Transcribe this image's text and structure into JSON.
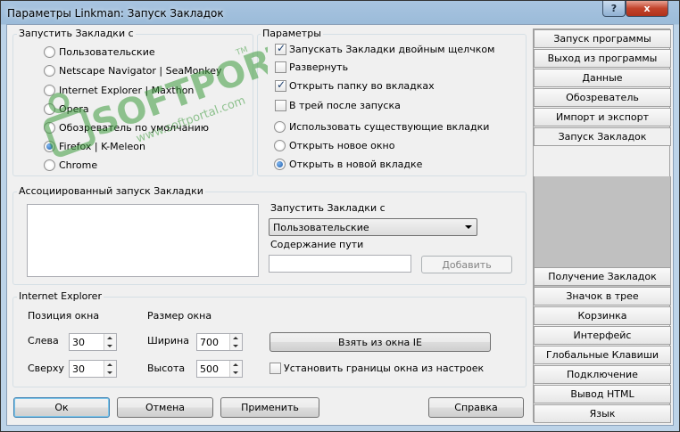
{
  "window": {
    "title": "Параметры Linkman: Запуск Закладок",
    "help_glyph": "?",
    "close_glyph": "x"
  },
  "launch_group": {
    "title": "Запустить Закладки с",
    "options": [
      "Пользовательские",
      "Netscape Navigator | SeaMonkey",
      "Internet Explorer | Maxthon",
      "Opera",
      "Обозреватель по умолчанию",
      "Firefox | K-Meleon",
      "Chrome"
    ],
    "selected": "Firefox | K-Meleon"
  },
  "params_group": {
    "title": "Параметры",
    "checkboxes": [
      {
        "label": "Запускать Закладки двойным щелчком",
        "checked": true
      },
      {
        "label": "Развернуть",
        "checked": false
      },
      {
        "label": "Открыть папку во вкладках",
        "checked": true
      },
      {
        "label": "В трей после запуска",
        "checked": false
      }
    ],
    "radios": [
      {
        "label": "Использовать существующие вкладки",
        "checked": false
      },
      {
        "label": "Открыть новое окно",
        "checked": false
      },
      {
        "label": "Открыть в новой вкладке",
        "checked": true
      }
    ]
  },
  "assoc_group": {
    "title": "Ассоциированный запуск Закладки",
    "launch_label": "Запустить Закладки с",
    "launch_value": "Пользовательские",
    "path_label": "Содержание пути",
    "path_value": "",
    "add_button": "Добавить"
  },
  "ie_group": {
    "title": "Internet Explorer",
    "pos_label": "Позиция окна",
    "size_label": "Размер окна",
    "left_label": "Слева",
    "left_value": "30",
    "top_label": "Сверху",
    "top_value": "30",
    "width_label": "Ширина",
    "width_value": "700",
    "height_label": "Высота",
    "height_value": "500",
    "take_button": "Взять из окна IE",
    "bounds_checkbox": "Установить границы окна из настроек",
    "bounds_checked": false
  },
  "buttons": {
    "ok": "Ок",
    "cancel": "Отмена",
    "apply": "Применить",
    "help": "Справка"
  },
  "nav": {
    "top": [
      "Запуск программы",
      "Выход из программы",
      "Данные",
      "Обозреватель",
      "Импорт и экспорт",
      "Запуск Закладок"
    ],
    "bottom": [
      "Получение Закладок",
      "Значок в трее",
      "Корзинка",
      "Интерфейс",
      "Глобальные Клавиши",
      "Подключение",
      "Вывод HTML",
      "Язык"
    ],
    "active": "Запуск Закладок"
  },
  "watermark": {
    "brand": "SOFTPORTAL",
    "tm": "TM",
    "url": "www.softportal.com"
  },
  "colors": {
    "accent": "#1d5aa8",
    "watermark_green": "#3e9b3e"
  }
}
